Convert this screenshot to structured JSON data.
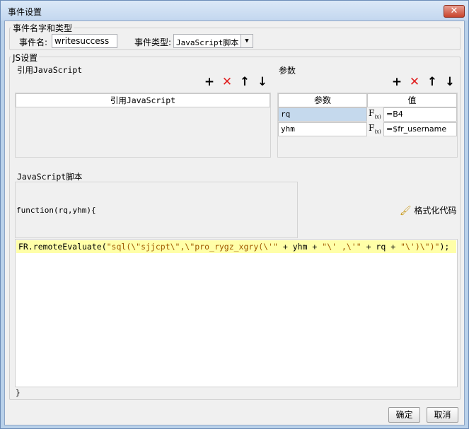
{
  "window": {
    "title": "事件设置",
    "close_label": "✕"
  },
  "event_name_group": {
    "title": "事件名字和类型",
    "name_label": "事件名:",
    "name_value": "writesuccess",
    "type_label": "事件类型:",
    "type_value": "JavaScript脚本"
  },
  "js_group": {
    "title": "JS设置",
    "ref_js": {
      "title": "引用JavaScript",
      "column_header": "引用JavaScript",
      "items": []
    },
    "params": {
      "title": "参数",
      "column_param": "参数",
      "column_value": "值",
      "rows": [
        {
          "name": "rq",
          "value": "=B4"
        },
        {
          "name": "yhm",
          "value": "=$fr_username"
        }
      ]
    },
    "script": {
      "title": "JavaScript脚本",
      "header_line": "function(rq,yhm){",
      "code_prefix": "FR.remoteEvaluate(",
      "code_string1": "\"sql(\\\"sjjcpt\\\",\\\"pro_rygz_xgry(\\'\"",
      "code_op1": " + yhm + ",
      "code_string2": "\"\\' ,\\'\"",
      "code_op2": " + rq + ",
      "code_string3": "\"\\')\\\")\"",
      "code_suffix": ");",
      "footer_line": "}",
      "format_label": "格式化代码"
    }
  },
  "buttons": {
    "ok": "确定",
    "cancel": "取消"
  },
  "icons": {
    "add": "plus-icon",
    "delete": "delete-x-icon",
    "up": "arrow-up-icon",
    "down": "arrow-down-icon",
    "formula": "formula-fx-icon",
    "format": "brush-icon"
  },
  "colors": {
    "delete_icon": "#e02020",
    "highlight_line": "#ffffa8",
    "selected_cell": "#c5d9ed"
  }
}
